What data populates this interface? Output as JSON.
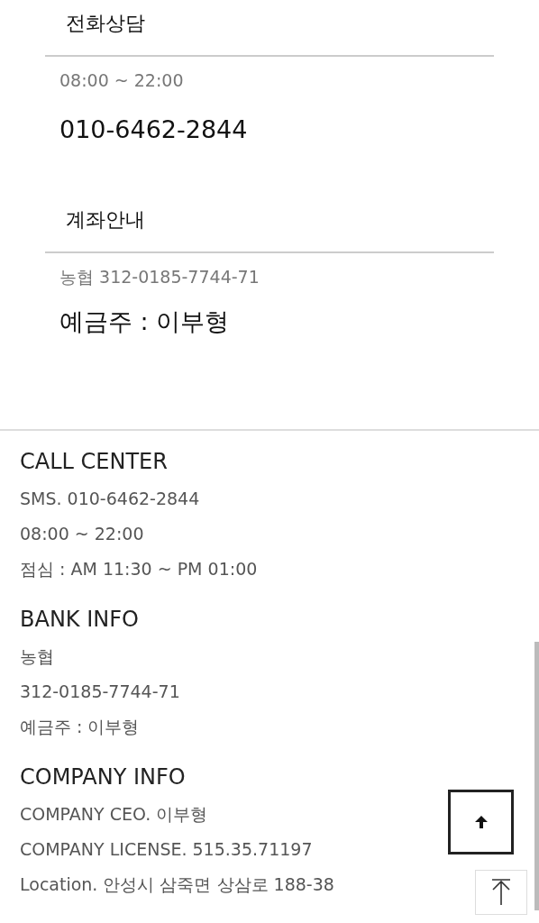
{
  "contact_sections": [
    {
      "title": "전화상담",
      "detail": "08:00 ~ 22:00",
      "main": "010-6462-2844"
    },
    {
      "title": "계좌안내",
      "detail": "농협 312-0185-7744-71",
      "main": "예금주 : 이부형"
    }
  ],
  "footer_groups": [
    {
      "heading": "CALL CENTER",
      "lines": [
        "SMS. 010-6462-2844",
        "08:00 ~ 22:00",
        "점심 : AM 11:30 ~ PM 01:00"
      ]
    },
    {
      "heading": "BANK INFO",
      "lines": [
        "농협",
        "312-0185-7744-71",
        "예금주 : 이부형"
      ]
    },
    {
      "heading": "COMPANY INFO",
      "lines": [
        "COMPANY CEO. 이부형",
        "COMPANY LICENSE. 515.35.71197",
        "Location. 안성시 삼죽면 상삼로 188-38"
      ]
    }
  ]
}
